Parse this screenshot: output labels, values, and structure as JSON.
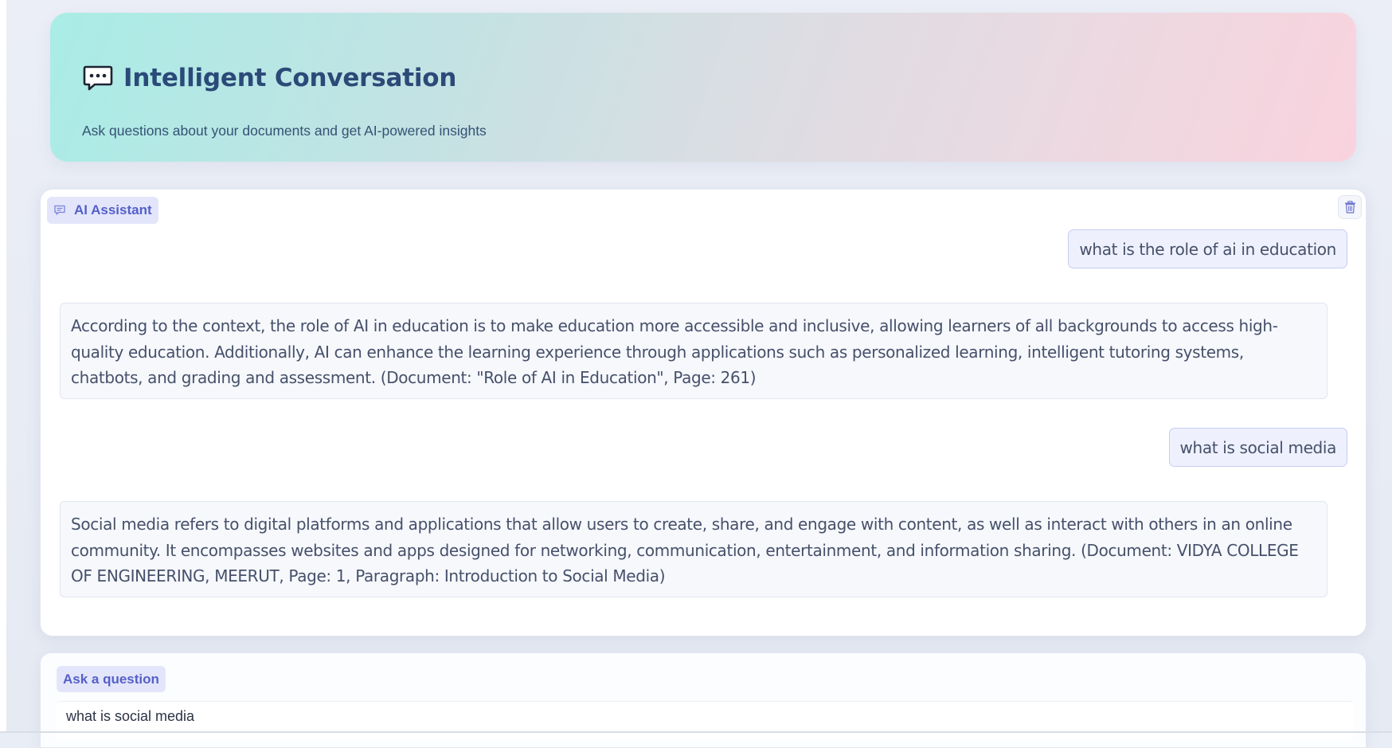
{
  "header": {
    "title": "Intelligent Conversation",
    "subtitle": "Ask questions about your documents and get AI-powered insights",
    "icon": "chat-bubble-dots-icon"
  },
  "chat": {
    "assistant_label": "AI Assistant",
    "clear_icon": "trash-icon",
    "messages": [
      {
        "role": "user",
        "text": "what is the role of ai in education"
      },
      {
        "role": "assistant",
        "text": "According to the context, the role of AI in education is to make education more accessible and inclusive, allowing learners of all backgrounds to access high-quality education. Additionally, AI can enhance the learning experience through applications such as personalized learning, intelligent tutoring systems, chatbots, and grading and assessment. (Document: \"Role of AI in Education\", Page: 261)"
      },
      {
        "role": "user",
        "text": "what is social media"
      },
      {
        "role": "assistant",
        "text": "Social media refers to digital platforms and applications that allow users to create, share, and engage with content, as well as interact with others in an online community. It encompasses websites and apps designed for networking, communication, entertainment, and information sharing. (Document: VIDYA COLLEGE OF ENGINEERING, MEERUT, Page: 1, Paragraph: Introduction to Social Media)"
      }
    ]
  },
  "input": {
    "label": "Ask a question",
    "value": "what is social media"
  },
  "colors": {
    "accent": "#5560c8",
    "title": "#2b4a78",
    "hero_start": "#a9ece6",
    "hero_end": "#f9d3de"
  }
}
